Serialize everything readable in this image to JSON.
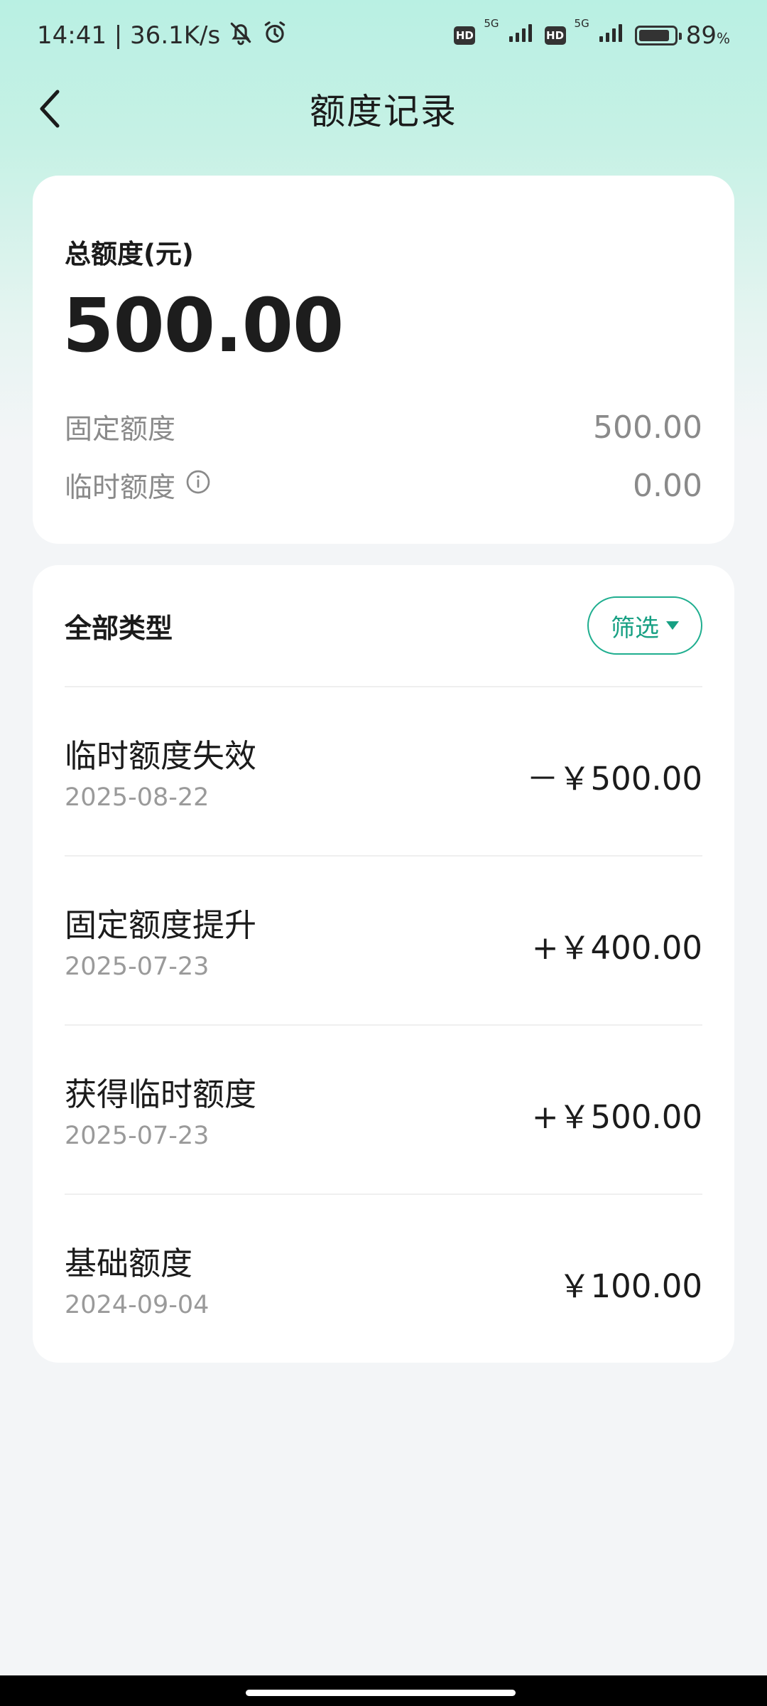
{
  "status_bar": {
    "time_speed": "14:41 | 36.1K/s",
    "hd_1": "HD",
    "net_1": "5G",
    "hd_2": "HD",
    "net_2": "5G",
    "battery_level": 0.89,
    "battery_text": "89",
    "battery_unit": "%"
  },
  "header": {
    "title": "额度记录"
  },
  "summary": {
    "total_label": "总额度(元)",
    "total_value": "500.00",
    "fixed_label": "固定额度",
    "fixed_value": "500.00",
    "temp_label": "临时额度",
    "temp_value": "0.00"
  },
  "records": {
    "title": "全部类型",
    "filter_label": "筛选",
    "items": [
      {
        "title": "临时额度失效",
        "date": "2025-08-22",
        "amount": "－￥500.00"
      },
      {
        "title": "固定额度提升",
        "date": "2025-07-23",
        "amount": "+￥400.00"
      },
      {
        "title": "获得临时额度",
        "date": "2025-07-23",
        "amount": "+￥500.00"
      },
      {
        "title": "基础额度",
        "date": "2024-09-04",
        "amount": "￥100.00"
      }
    ]
  },
  "colors": {
    "accent": "#17a083",
    "header_gradient": "#b9f0e3",
    "background": "#f3f5f7"
  }
}
